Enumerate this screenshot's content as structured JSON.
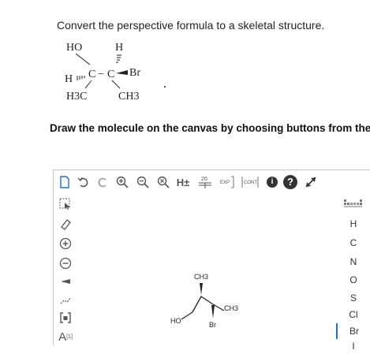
{
  "question": {
    "prompt": "Convert the perspective formula to a skeletal structure.",
    "instruction": "Draw the molecule on the canvas by choosing buttons from the"
  },
  "perspective_formula": {
    "labels": {
      "ho": "HO",
      "h_top": "H",
      "h_left": "H",
      "br": "Br",
      "h3c": "H3C",
      "ch3": "CH3",
      "c_left": "C",
      "c_right": "C",
      "dash": "−"
    }
  },
  "toolbar": {
    "template_20": "20",
    "exp": "EXP",
    "cont": "CONT",
    "h_plus": "H±",
    "info": "i",
    "help": "?"
  },
  "left_tools": {
    "atom_label": "A",
    "atom_sup": "[1]"
  },
  "elements": {
    "items": [
      "H",
      "C",
      "N",
      "O",
      "S",
      "Cl",
      "Br",
      "I"
    ],
    "selected": "Br",
    "periodic_icon": "periodic-table-icon"
  },
  "canvas_molecule": {
    "labels": {
      "ho": "HO",
      "ch3_top": "CH3",
      "ch3_right": "CH3",
      "br": "Br"
    }
  },
  "colors": {
    "accent": "#1a73c8",
    "icon_gray": "#555555",
    "dark_circle": "#333333"
  }
}
